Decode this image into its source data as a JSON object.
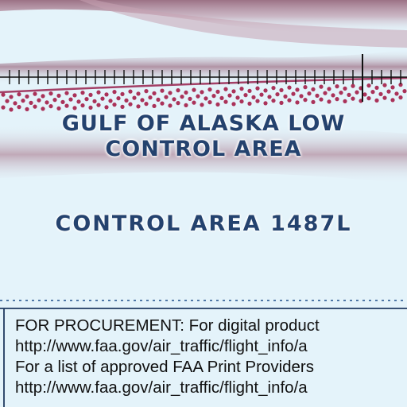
{
  "map": {
    "area_name_line1": "GULF OF ALASKA LOW",
    "area_name_line2": "CONTROL AREA",
    "control_area_label": "CONTROL AREA 1487L"
  },
  "notes": {
    "lines": [
      "FOR PROCUREMENT:  For digital product",
      "http://www.faa.gov/air_traffic/flight_info/a",
      "For a list of approved FAA Print Providers",
      "http://www.faa.gov/air_traffic/flight_info/a"
    ]
  },
  "colors": {
    "water": "#e4f3fa",
    "label_text": "#24426e",
    "boundary_band": "#8a4a63",
    "boundary_dots": "#a31d47",
    "tick_line": "#111111"
  }
}
